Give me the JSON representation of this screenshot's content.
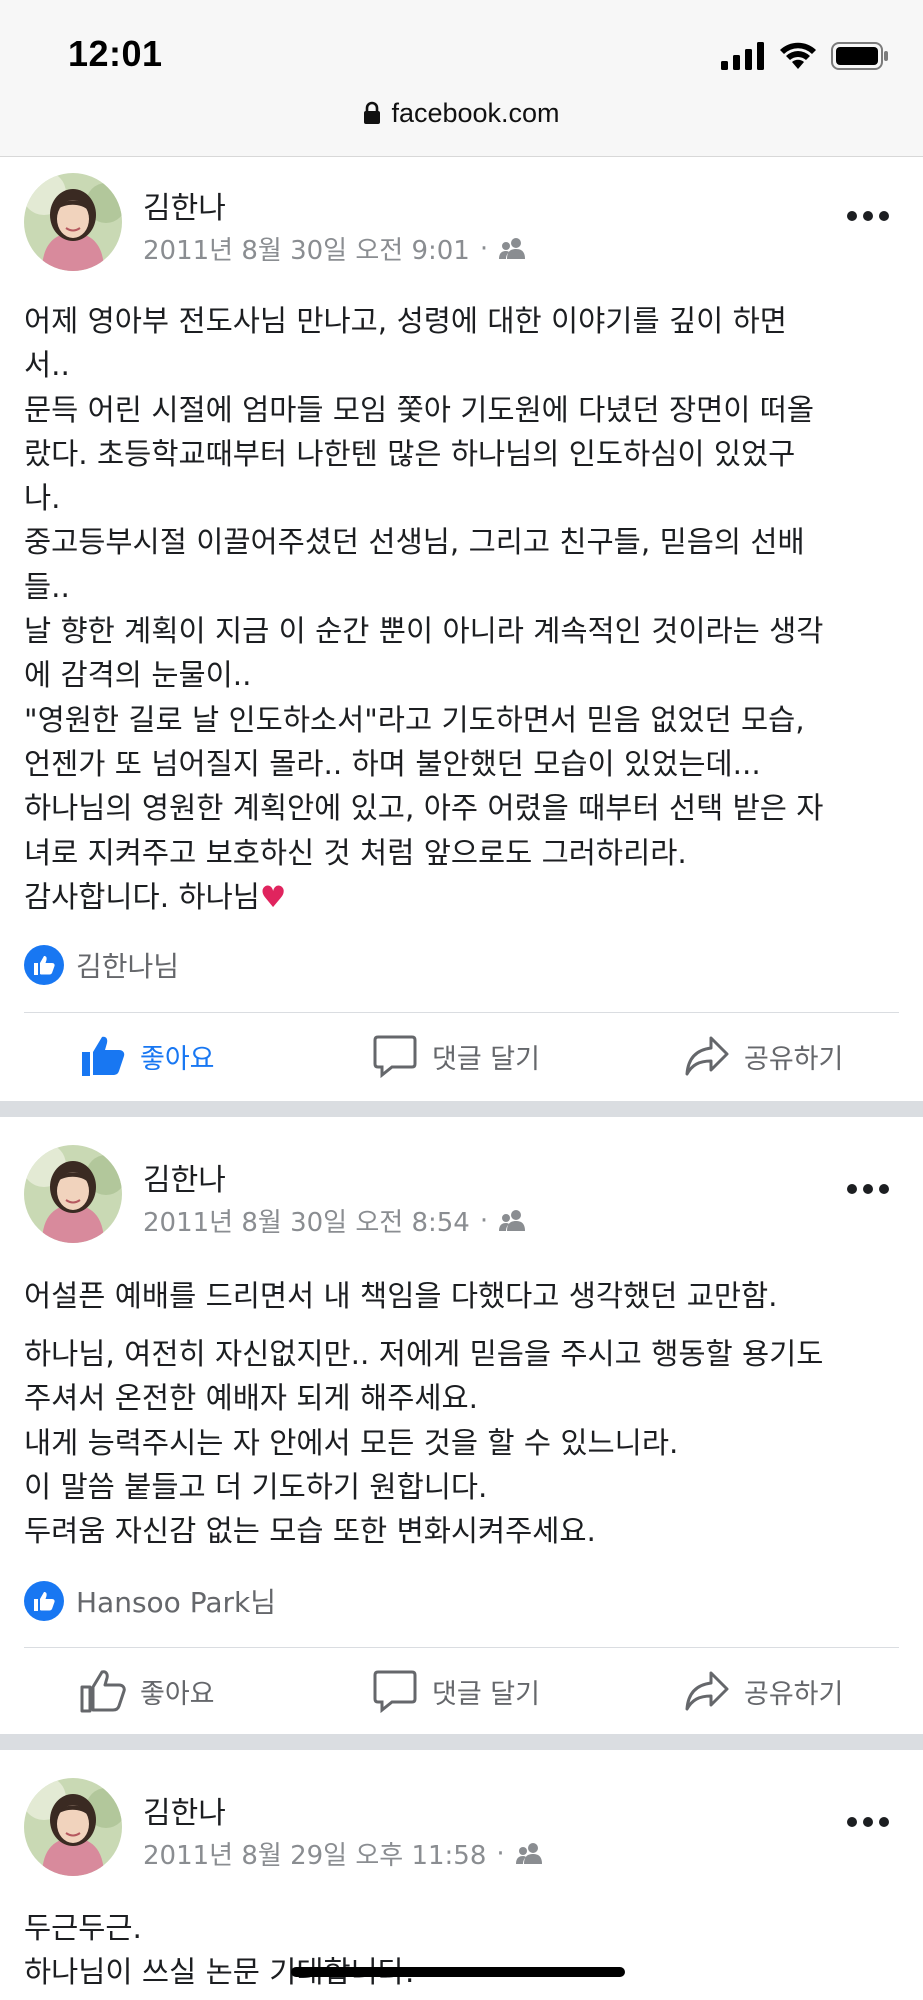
{
  "status_bar": {
    "time": "12:01",
    "url": "facebook.com"
  },
  "icons": {
    "lock": "lock-icon",
    "signal": "signal-icon",
    "wifi": "wifi-icon",
    "battery": "battery-icon",
    "audience": "friends-icon",
    "more": "more-icon",
    "like": "thumbs-up-icon",
    "comment": "comment-icon",
    "share": "share-icon"
  },
  "colors": {
    "facebook_blue": "#1877f2",
    "meta_gray": "#8a8d91",
    "heart": "#e0245e"
  },
  "posts": [
    {
      "author": "김한나",
      "timestamp": "2011년 8월 30일 오전 9:01",
      "dot": "·",
      "text": "어제 영아부 전도사님 만나고, 성령에 대한 이야기를 깊이 하면\n서..\n문득 어린 시절에 엄마들 모임 쫓아 기도원에 다녔던 장면이 떠올\n랐다. 초등학교때부터 나한텐 많은 하나님의 인도하심이 있었구\n나.\n중고등부시절 이끌어주셨던 선생님, 그리고 친구들, 믿음의 선배\n들..\n날 향한 계획이 지금 이 순간 뿐이 아니라 계속적인 것이라는 생각\n에 감격의 눈물이..\n\"영원한 길로 날 인도하소서\"라고 기도하면서 믿음 없었던 모습,\n언젠가 또 넘어질지 몰라.. 하며 불안했던 모습이 있었는데...\n하나님의 영원한 계획안에 있고, 아주 어렸을 때부터 선택 받은 자\n녀로 지켜주고 보호하신 것 처럼 앞으로도 그러하리라.\n감사합니다. 하나님",
      "heart": "♥",
      "reactions": "김한나님",
      "liked": true
    },
    {
      "author": "김한나",
      "timestamp": "2011년 8월 30일 오전 8:54",
      "dot": "·",
      "text_first": "어설픈 예배를 드리면서 내 책임을 다했다고 생각했던 교만함.",
      "text": "하나님, 여전히 자신없지만.. 저에게 믿음을 주시고 행동할 용기도\n주셔서 온전한 예배자 되게 해주세요.\n내게 능력주시는 자 안에서 모든 것을 할 수 있느니라.\n이 말씀 붙들고 더 기도하기 원합니다.\n두려움 자신감 없는 모습 또한 변화시켜주세요.",
      "reactions": "Hansoo Park님",
      "liked": false
    },
    {
      "author": "김한나",
      "timestamp": "2011년 8월 29일 오후 11:58",
      "dot": "·",
      "text": "두근두근.\n하나님이 쓰실 논문 기대합니다."
    }
  ],
  "actions": {
    "like": "좋아요",
    "comment": "댓글 달기",
    "share": "공유하기"
  }
}
